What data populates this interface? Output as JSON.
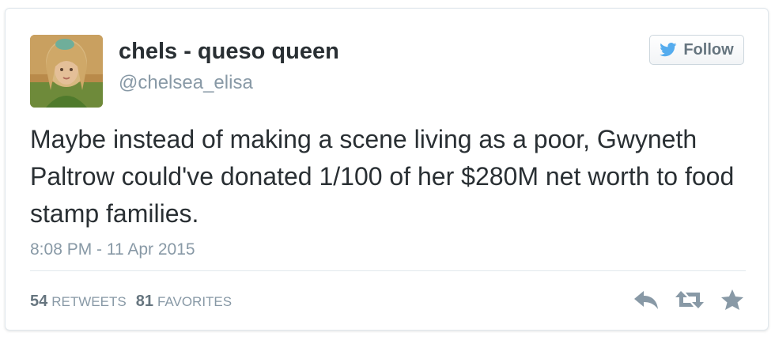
{
  "user": {
    "display_name": "chels - queso queen",
    "handle": "@chelsea_elisa"
  },
  "follow_button": {
    "label": "Follow",
    "icon": "bird-icon",
    "icon_color": "#55acee"
  },
  "tweet": {
    "text": "Maybe instead of making a scene living as a poor, Gwyneth Paltrow could've donated 1/100 of her $280M net worth to food stamp families.",
    "timestamp": "8:08 PM - 11 Apr 2015"
  },
  "stats": {
    "retweets_count": "54",
    "retweets_label": "RETWEETS",
    "favorites_count": "81",
    "favorites_label": "FAVORITES"
  },
  "actions": [
    "reply-icon",
    "retweet-icon",
    "favorite-star-icon"
  ],
  "colors": {
    "text_primary": "#292f33",
    "text_secondary": "#8899a6",
    "icon_gray": "#8899a6"
  }
}
